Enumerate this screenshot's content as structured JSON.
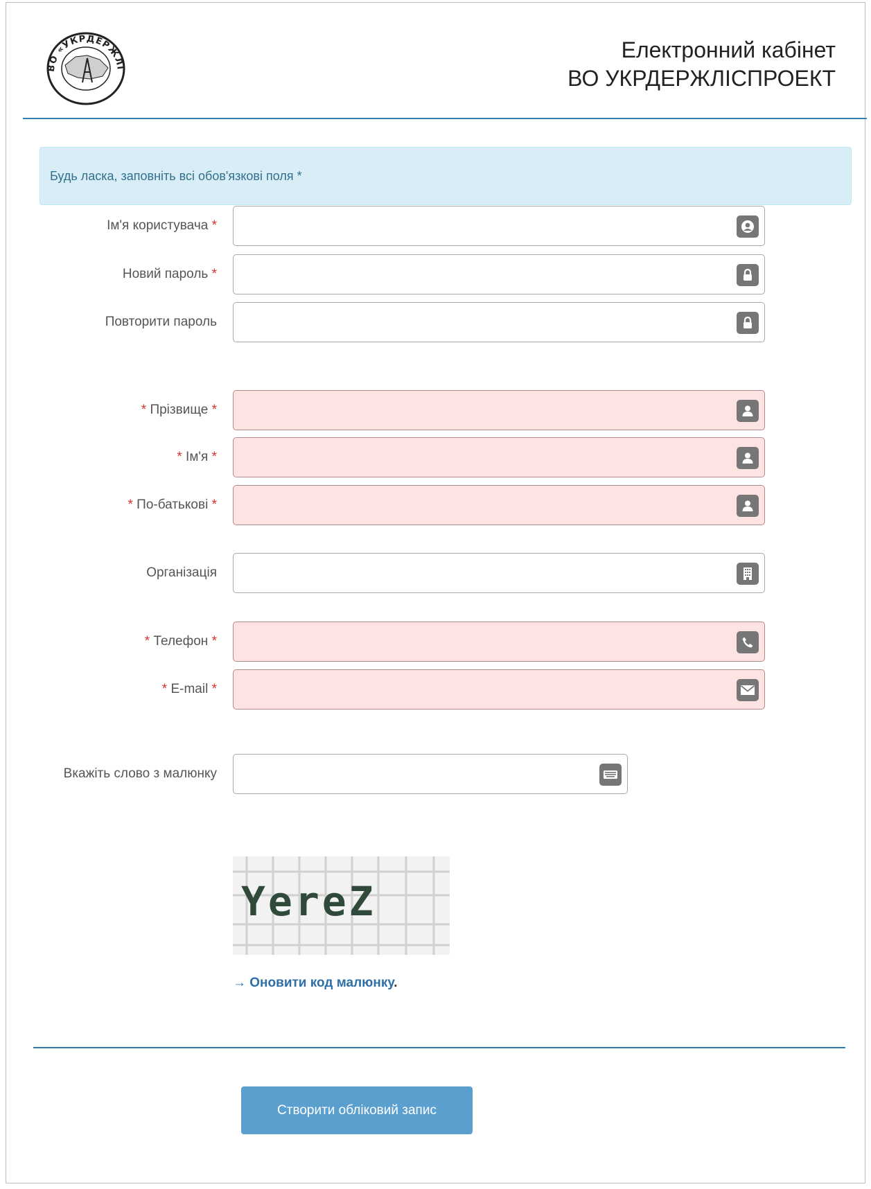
{
  "header": {
    "title_line1": "Електронний кабінет",
    "title_line2": "ВО УКРДЕРЖЛІСПРОЕКТ",
    "logo_text": "ВО «УКРДЕРЖЛІСПРОЕКТ»"
  },
  "alert": {
    "text": "Будь ласка, заповніть всі обов'язкові поля *"
  },
  "form": {
    "username": {
      "label": "Ім'я користувача",
      "required_mark": "*",
      "value": "",
      "icon": "user-circle-icon"
    },
    "new_password": {
      "label": "Новий пароль",
      "required_mark": "*",
      "value": "",
      "icon": "lock-icon"
    },
    "repeat_password": {
      "label": "Повторити пароль",
      "value": "",
      "icon": "lock-icon"
    },
    "surname": {
      "prefix_mark": "*",
      "label": "Прізвище",
      "required_mark": "*",
      "value": "",
      "icon": "user-icon"
    },
    "first_name": {
      "prefix_mark": "*",
      "label": "Ім'я",
      "required_mark": "*",
      "value": "",
      "icon": "user-icon"
    },
    "patronymic": {
      "prefix_mark": "*",
      "label": "По-батькові",
      "required_mark": "*",
      "value": "",
      "icon": "user-icon"
    },
    "organization": {
      "label": "Організація",
      "value": "",
      "icon": "building-icon"
    },
    "phone": {
      "prefix_mark": "*",
      "label": "Телефон",
      "required_mark": "*",
      "value": "",
      "icon": "phone-icon"
    },
    "email": {
      "prefix_mark": "*",
      "label": "E-mail",
      "required_mark": "*",
      "value": "",
      "icon": "envelope-icon"
    },
    "captcha": {
      "label": "Вкажіть слово з малюнку",
      "value": "",
      "icon": "keyboard-icon",
      "image_text": "YereZ"
    }
  },
  "refresh_link": {
    "arrow": "→",
    "text": "Оновити код малюнку",
    "suffix": "."
  },
  "submit_button": {
    "label": "Створити обліковий запис"
  },
  "colors": {
    "accent": "#2f7fb0",
    "error_bg": "#fde3e1",
    "alert_bg": "#d9edf7",
    "button": "#5b9fcf"
  }
}
